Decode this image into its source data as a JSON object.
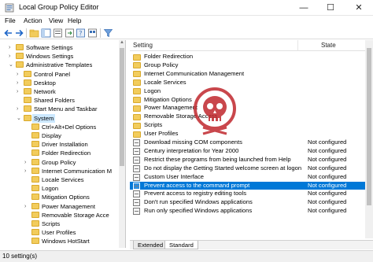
{
  "window": {
    "title": "Local Group Policy Editor",
    "min_icon": "minimize-icon",
    "max_icon": "maximize-icon",
    "close_icon": "close-icon"
  },
  "menu": [
    "File",
    "Action",
    "View",
    "Help"
  ],
  "tree": [
    {
      "label": "Software Settings",
      "level": 2,
      "chev": "›"
    },
    {
      "label": "Windows Settings",
      "level": 2,
      "chev": "›"
    },
    {
      "label": "Administrative Templates",
      "level": 2,
      "chev": "⌄"
    },
    {
      "label": "Control Panel",
      "level": 3,
      "chev": "›"
    },
    {
      "label": "Desktop",
      "level": 3,
      "chev": "›"
    },
    {
      "label": "Network",
      "level": 3,
      "chev": "›"
    },
    {
      "label": "Shared Folders",
      "level": 3,
      "chev": ""
    },
    {
      "label": "Start Menu and Taskbar",
      "level": 3,
      "chev": "›"
    },
    {
      "label": "System",
      "level": 3,
      "chev": "⌄",
      "selected": true
    },
    {
      "label": "Ctrl+Alt+Del Options",
      "level": 4,
      "chev": ""
    },
    {
      "label": "Display",
      "level": 4,
      "chev": ""
    },
    {
      "label": "Driver Installation",
      "level": 4,
      "chev": ""
    },
    {
      "label": "Folder Redirection",
      "level": 4,
      "chev": ""
    },
    {
      "label": "Group Policy",
      "level": 4,
      "chev": "›"
    },
    {
      "label": "Internet Communication M",
      "level": 4,
      "chev": "›"
    },
    {
      "label": "Locale Services",
      "level": 4,
      "chev": ""
    },
    {
      "label": "Logon",
      "level": 4,
      "chev": ""
    },
    {
      "label": "Mitigation Options",
      "level": 4,
      "chev": ""
    },
    {
      "label": "Power Management",
      "level": 4,
      "chev": "›"
    },
    {
      "label": "Removable Storage Acce",
      "level": 4,
      "chev": ""
    },
    {
      "label": "Scripts",
      "level": 4,
      "chev": ""
    },
    {
      "label": "User Profiles",
      "level": 4,
      "chev": ""
    },
    {
      "label": "Windows HotStart",
      "level": 4,
      "chev": ""
    }
  ],
  "columns": {
    "setting": "Setting",
    "state": "State"
  },
  "rows": [
    {
      "type": "folder",
      "name": "Folder Redirection",
      "state": ""
    },
    {
      "type": "folder",
      "name": "Group Policy",
      "state": ""
    },
    {
      "type": "folder",
      "name": "Internet Communication Management",
      "state": ""
    },
    {
      "type": "folder",
      "name": "Locale Services",
      "state": ""
    },
    {
      "type": "folder",
      "name": "Logon",
      "state": ""
    },
    {
      "type": "folder",
      "name": "Mitigation Options",
      "state": ""
    },
    {
      "type": "folder",
      "name": "Power Management",
      "state": ""
    },
    {
      "type": "folder",
      "name": "Removable Storage Access",
      "state": ""
    },
    {
      "type": "folder",
      "name": "Scripts",
      "state": ""
    },
    {
      "type": "folder",
      "name": "User Profiles",
      "state": ""
    },
    {
      "type": "setting",
      "name": "Download missing COM components",
      "state": "Not configured"
    },
    {
      "type": "setting",
      "name": "Century interpretation for Year 2000",
      "state": "Not configured"
    },
    {
      "type": "setting",
      "name": "Restrict these programs from being launched from Help",
      "state": "Not configured"
    },
    {
      "type": "setting",
      "name": "Do not display the Getting Started welcome screen at logon",
      "state": "Not configured"
    },
    {
      "type": "setting",
      "name": "Custom User Interface",
      "state": "Not configured"
    },
    {
      "type": "setting",
      "name": "Prevent access to the command prompt",
      "state": "Not configured",
      "selected": true
    },
    {
      "type": "setting",
      "name": "Prevent access to registry editing tools",
      "state": "Not configured"
    },
    {
      "type": "setting",
      "name": "Don't run specified Windows applications",
      "state": "Not configured"
    },
    {
      "type": "setting",
      "name": "Run only specified Windows applications",
      "state": "Not configured"
    }
  ],
  "tabs": [
    "Extended",
    "Standard"
  ],
  "status": "10 setting(s)",
  "colors": {
    "selection": "#0078d7",
    "tree_selection": "#cce8ff",
    "folder": "#f2cc5c",
    "watermark": "#c0282d"
  }
}
